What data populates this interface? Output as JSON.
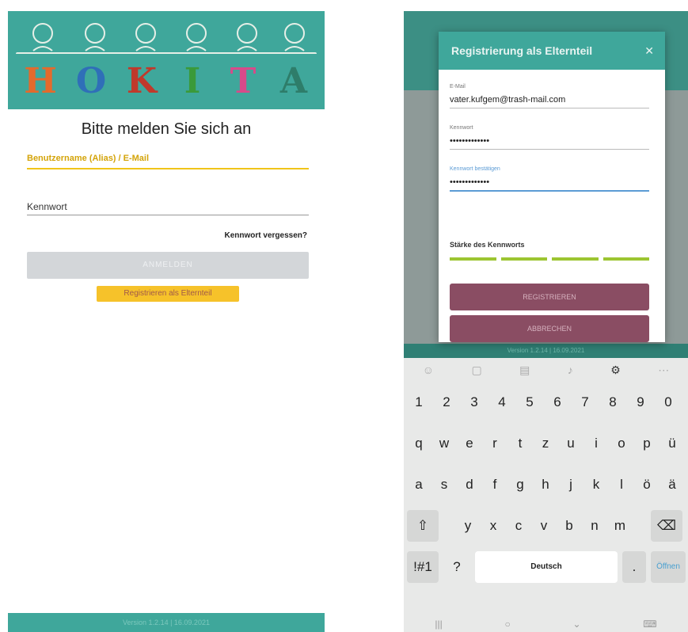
{
  "left": {
    "login_title": "Bitte melden Sie sich an",
    "username_label": "Benutzername (Alias) / E-Mail",
    "password_label": "Kennwort",
    "forgot_link": "Kennwort vergessen?",
    "login_button": "ANMELDEN",
    "register_parent_button": "Registrieren als Elternteil",
    "logo_letters": [
      "H",
      "O",
      "K",
      "I",
      "T",
      "A"
    ],
    "logo_colors": [
      "#e46a2c",
      "#2f6fb8",
      "#c0392b",
      "#3a9a3a",
      "#d84a8a",
      "#2e7d6a"
    ],
    "footer": "Version 1.2.14 | 16.09.2021"
  },
  "right": {
    "dialog_title": "Registrierung als Elternteil",
    "close_icon": "close-icon",
    "email_label": "E-Mail",
    "email_value": "vater.kufgem@trash-mail.com",
    "password_label": "Kennwort",
    "password_value": "•••••••••••••",
    "confirm_label": "Kennwort bestätigen",
    "confirm_value": "•••••••••••••",
    "strength_label": "Stärke des Kennworts",
    "register_button": "REGISTRIEREN",
    "cancel_button": "ABBRECHEN",
    "bg_footer": "Version 1.2.14 | 16.09.2021"
  },
  "keyboard": {
    "row_numbers": [
      "1",
      "2",
      "3",
      "4",
      "5",
      "6",
      "7",
      "8",
      "9",
      "0"
    ],
    "row_1": [
      "q",
      "w",
      "e",
      "r",
      "t",
      "z",
      "u",
      "i",
      "o",
      "p",
      "ü"
    ],
    "row_2": [
      "a",
      "s",
      "d",
      "f",
      "g",
      "h",
      "j",
      "k",
      "l",
      "ö",
      "ä"
    ],
    "row_3": [
      "y",
      "x",
      "c",
      "v",
      "b",
      "n",
      "m"
    ],
    "shift": "⇧",
    "backspace": "⌫",
    "symbols": "!#1",
    "question": "?",
    "space": "Deutsch",
    "period": ".",
    "enter": "Öffnen"
  }
}
